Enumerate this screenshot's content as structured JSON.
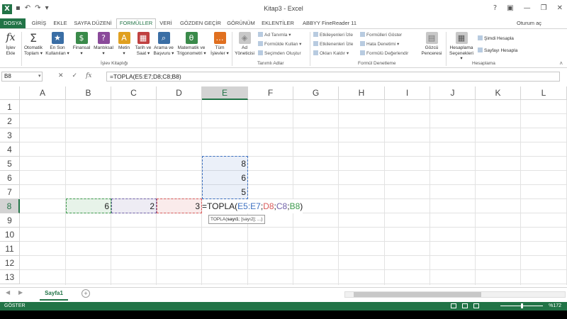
{
  "window": {
    "title": "Kitap3 - Excel",
    "app_icon": "X"
  },
  "tabs": [
    {
      "label": "DOSYA"
    },
    {
      "label": "GİRİŞ"
    },
    {
      "label": "EKLE"
    },
    {
      "label": "SAYFA DÜZENİ"
    },
    {
      "label": "FORMÜLLER"
    },
    {
      "label": "VERİ"
    },
    {
      "label": "GÖZDEN GEÇİR"
    },
    {
      "label": "GÖRÜNÜM"
    },
    {
      "label": "EKLENTİLER"
    },
    {
      "label": "ABBYY FineReader 11"
    }
  ],
  "active_tab": "FORMÜLLER",
  "user": {
    "signin": "Oturum aç"
  },
  "ribbon": {
    "insert_function": {
      "line1": "İşlev",
      "line2": "Ekle"
    },
    "library": [
      {
        "line1": "Otomatik",
        "line2": "Toplam ▾",
        "icon": "Σ",
        "color": "#4a4a4a"
      },
      {
        "line1": "En Son",
        "line2": "Kullanılan ▾",
        "icon": "★",
        "color": "#3a6ea5"
      },
      {
        "line1": "Finansal",
        "line2": "▾",
        "icon": "$",
        "color": "#3a8a4a"
      },
      {
        "line1": "Mantıksal",
        "line2": "▾",
        "icon": "?",
        "color": "#8a4a9a"
      },
      {
        "line1": "Metin",
        "line2": "▾",
        "icon": "A",
        "color": "#e0a020"
      },
      {
        "line1": "Tarih ve",
        "line2": "Saat ▾",
        "icon": "▦",
        "color": "#c04040"
      },
      {
        "line1": "Arama ve",
        "line2": "Başvuru ▾",
        "icon": "⌕",
        "color": "#3a6ea5"
      },
      {
        "line1": "Matematik ve",
        "line2": "Trigonometri ▾",
        "icon": "θ",
        "color": "#3a8a4a"
      },
      {
        "line1": "Tüm",
        "line2": "İşlevler ▾",
        "icon": "…",
        "color": "#e07020"
      }
    ],
    "library_label": "İşlev Kitaplığı",
    "names": {
      "manager_line1": "Ad",
      "manager_line2": "Yöneticisi",
      "define": "Ad Tanımla ▾",
      "use_in_formula": "Formülde Kullan ▾",
      "create_from_selection": "Seçimden Oluştur"
    },
    "names_label": "Tanımlı Adlar",
    "auditing": {
      "trace_precedents": "Etkileyenleri İzle",
      "trace_dependents": "Etkilenenleri İzle",
      "remove_arrows": "Okları Kaldır ▾",
      "show_formulas": "Formülleri Göster",
      "error_checking": "Hata Denetimi ▾",
      "evaluate_formula": "Formülü Değerlendir",
      "watch_line1": "Gözcü",
      "watch_line2": "Penceresi"
    },
    "auditing_label": "Formül Denetleme",
    "calculation": {
      "options_line1": "Hesaplama",
      "options_line2": "Seçenekleri ▾",
      "calc_now": "Şimdi Hesapla",
      "calc_sheet": "Sayfayı Hesapla"
    },
    "calculation_label": "Hesaplama"
  },
  "formula_bar": {
    "name_box": "B8",
    "formula": "=TOPLA(E5:E7;D8;C8;B8)",
    "cancel": "✕",
    "enter": "✓",
    "fx": "fx"
  },
  "columns": [
    "A",
    "B",
    "C",
    "D",
    "E",
    "F",
    "G",
    "H",
    "I",
    "J",
    "K",
    "L"
  ],
  "selected_column": "E",
  "rows": [
    "1",
    "2",
    "3",
    "4",
    "5",
    "6",
    "7",
    "8",
    "9",
    "10",
    "11",
    "12",
    "13"
  ],
  "selected_row": "8",
  "cells": {
    "E5": "8",
    "E6": "6",
    "E7": "5",
    "B8": "6",
    "C8": "2",
    "D8": "3"
  },
  "edit_formula": {
    "prefix": "=TOPLA(",
    "ref1": "E5:E7",
    "sep1": ";",
    "ref2": "D8",
    "sep2": ";",
    "ref3": "C8",
    "sep3": ";",
    "ref4": "B8",
    "suffix": ")"
  },
  "ref_colors": {
    "E5:E7": "#3b6fc0",
    "D8": "#d85a5a",
    "C8": "#7060a8",
    "B8": "#3c9a4c"
  },
  "tooltip": {
    "func": "TOPLA(",
    "arg1": "sayı1",
    "rest": "; [sayı2]; ...)"
  },
  "sheets": [
    {
      "name": "Sayfa1"
    }
  ],
  "status": {
    "mode": "GÖSTER",
    "zoom": "%172"
  }
}
